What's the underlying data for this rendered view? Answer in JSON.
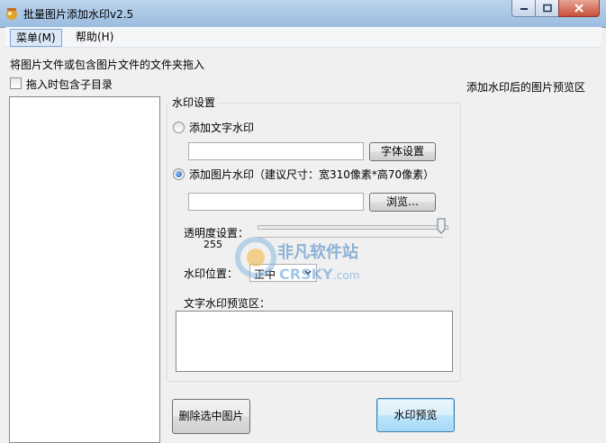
{
  "window": {
    "title": "批量图片添加水印v2.5"
  },
  "menu": {
    "main": "菜单(M)",
    "help": "帮助(H)"
  },
  "left": {
    "hint": "将图片文件或包含图片文件的文件夹拖入",
    "include_subdirs": "拖入时包含子目录",
    "delete_button": "删除选中图片"
  },
  "right": {
    "preview_label": "添加水印后的图片预览区"
  },
  "settings": {
    "group_title": "水印设置",
    "text_watermark": {
      "label": "添加文字水印",
      "selected": false,
      "value": "",
      "font_button": "字体设置"
    },
    "image_watermark": {
      "label": "添加图片水印（建议尺寸：宽310像素*高70像素）",
      "selected": true,
      "value": "",
      "browse_button": "浏览…"
    },
    "opacity": {
      "label": "透明度设置：",
      "value": "255",
      "max": 255
    },
    "position": {
      "label": "水印位置：",
      "selected": "正中"
    },
    "text_preview_label": "文字水印预览区：",
    "text_preview_value": ""
  },
  "preview_button": "水印预览",
  "overlay": {
    "brand_cn": "非凡软件站",
    "brand_en": "CRSKY",
    "brand_tld": ".com"
  }
}
